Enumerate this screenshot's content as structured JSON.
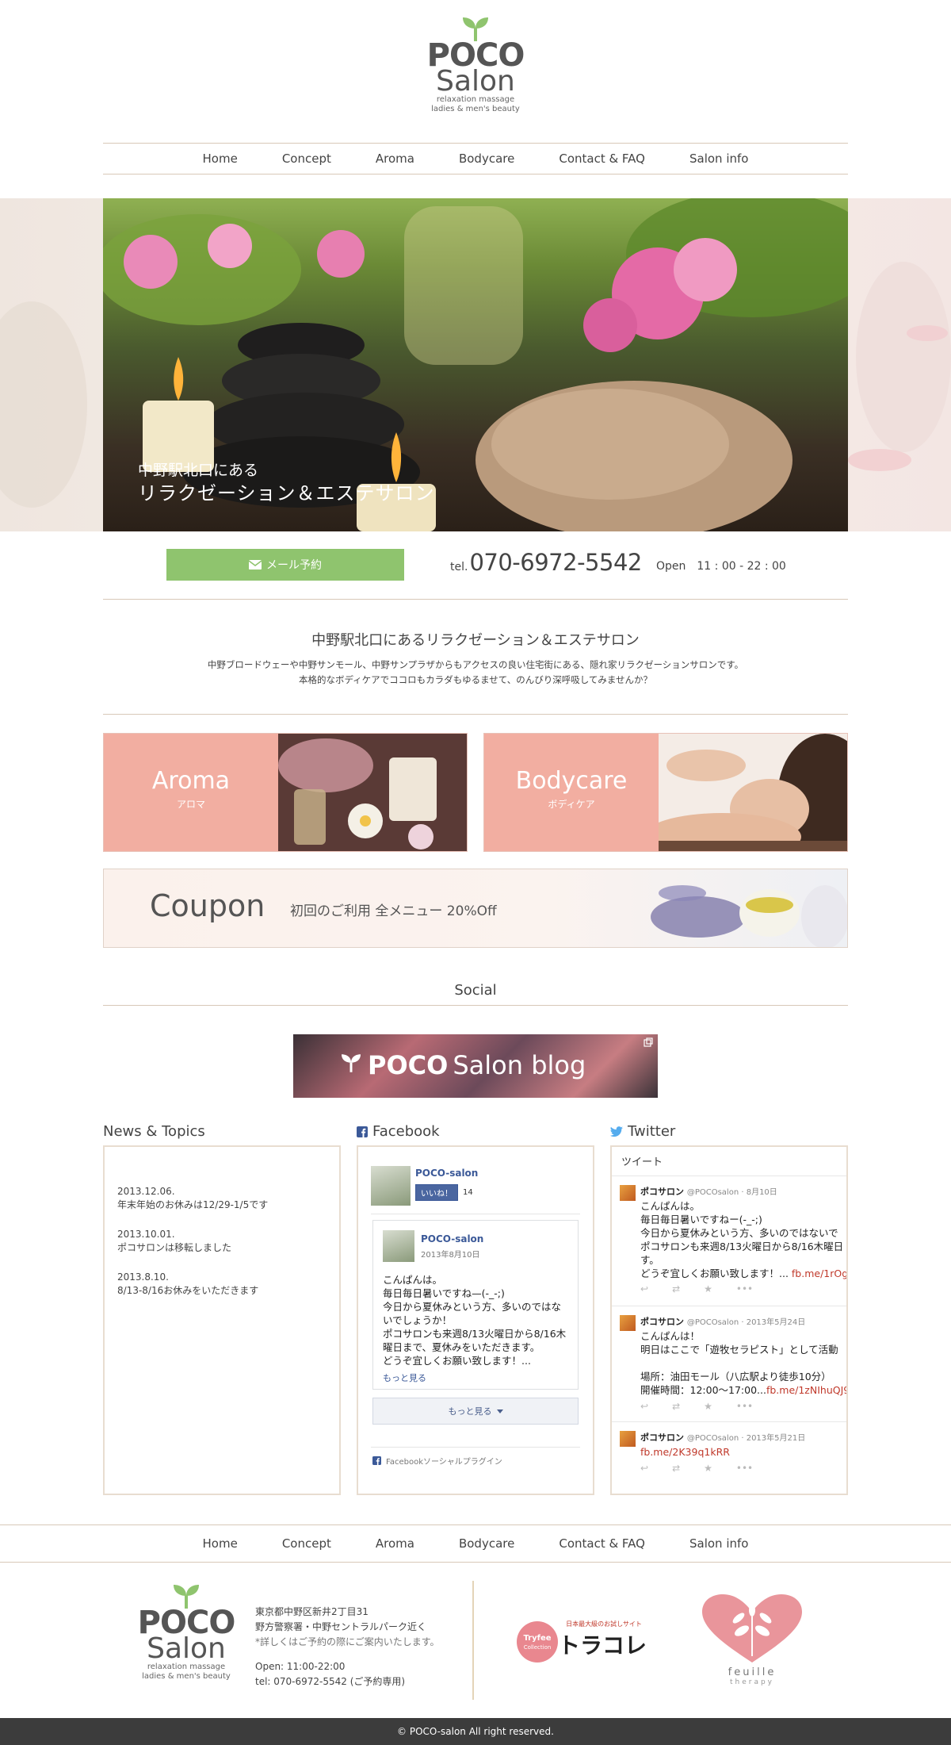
{
  "logo": {
    "poco": "POCO",
    "salon": "Salon",
    "tagline1": "relaxation massage",
    "tagline2": "ladies & men's beauty"
  },
  "nav": {
    "items": [
      "Home",
      "Concept",
      "Aroma",
      "Bodycare",
      "Contact & FAQ",
      "Salon info"
    ]
  },
  "hero": {
    "line1": "中野駅北口にある",
    "line2": "リラクゼーション＆エステサロン"
  },
  "booking": {
    "mail_button": "メール予約",
    "tel_label": "tel.",
    "tel_number": "070-6972-5542",
    "open_hours": "Open　11 : 00 - 22 : 00"
  },
  "intro": {
    "title": "中野駅北口にあるリラクゼーション＆エステサロン",
    "text1": "中野ブロードウェーや中野サンモール、中野サンプラザからもアクセスの良い住宅街にある、隠れ家リラクゼーションサロンです。",
    "text2": "本格的なボディケアでココロもカラダもゆるませて、のんびり深呼吸してみませんか？"
  },
  "banners": {
    "aroma": {
      "title": "Aroma",
      "sub": "アロマ"
    },
    "bodycare": {
      "title": "Bodycare",
      "sub": "ボディケア"
    },
    "coupon": {
      "title": "Coupon",
      "text": "初回のご利用 全メニュー 20%Off"
    }
  },
  "social": {
    "title": "Social",
    "blog_poco": "POCO",
    "blog_rest": "Salon blog"
  },
  "news": {
    "heading": "News & Topics",
    "items": [
      {
        "date": "2013.12.06.",
        "text": "年末年始のお休みは12/29-1/5です"
      },
      {
        "date": "2013.10.01.",
        "text": "ポコサロンは移転しました"
      },
      {
        "date": "2013.8.10.",
        "text": "8/13-8/16お休みをいただきます"
      }
    ]
  },
  "facebook": {
    "heading": "Facebook",
    "page_name": "POCO-salon",
    "like_label": "いいね！",
    "like_count": "14",
    "post_name": "POCO-salon",
    "post_date": "2013年8月10日",
    "post_lines": [
      "こんぱんは。",
      "毎日毎日暑いですね—(-_-;)",
      "今日から夏休みという方、多いのではな",
      "いでしょうか！",
      "ポコサロンも来週8/13火曜日から8/16木",
      "曜日まで、夏休みをいただきます。",
      "どうぞ宜しくお願い致します！..."
    ],
    "more_link": "もっと見る",
    "load_more": "もっと見る",
    "plugin": "Facebookソーシャルプラグイン"
  },
  "twitter": {
    "heading": "Twitter",
    "widget_title": "ツイート",
    "tweets": [
      {
        "name": "ポコサロン",
        "handle": "@POCOsalon · 8月10日",
        "lines": [
          "こんぱんは。",
          "毎日毎日暑いですねー(-_-;)",
          "今日から夏休みという方、多いのではないで",
          "ポコサロンも来週8/13火曜日から8/16木曜日",
          "す。"
        ],
        "last": "どうぞ宜しくお願い致します！...",
        "link": "fb.me/1rOg"
      },
      {
        "name": "ポコサロン",
        "handle": "@POCOsalon · 2013年5月24日",
        "lines": [
          "こんぱんは！",
          "明日はここで「遊牧セラピスト」として活動",
          "",
          "場所：油田モール（八広駅より徒歩10分）"
        ],
        "last": "開催時間：12:00〜17:00...",
        "link": "fb.me/1zNIhuQJ9"
      },
      {
        "name": "ポコサロン",
        "handle": "@POCOsalon · 2013年5月21日",
        "lines": [],
        "last": "",
        "link": "fb.me/2K39q1kRR"
      }
    ]
  },
  "footer": {
    "address1": "東京都中野区新井2丁目31",
    "address2": "野方警察署・中野セントラルパーク近く",
    "address3": "*詳しくはご予約の際にご案内いたします。",
    "open": "Open: 11:00-22:00",
    "tel": "tel: 070-6972-5542 (ご予約専用)",
    "trycolle_top": "日本最大級のお試しサイト",
    "trycolle_main": "トラコレ",
    "trycolle_badge1": "Tryfee",
    "trycolle_badge2": "Collection",
    "feuille": "feuille",
    "feuille_sub": "therapy",
    "copyright": "© POCO-salon All right reserved."
  },
  "colors": {
    "accent_green": "#8fc46e",
    "banner_pink": "#f2aea1",
    "rule_beige": "#d8c8b8",
    "facebook_blue": "#3b5998",
    "twitter_blue": "#55acee"
  }
}
